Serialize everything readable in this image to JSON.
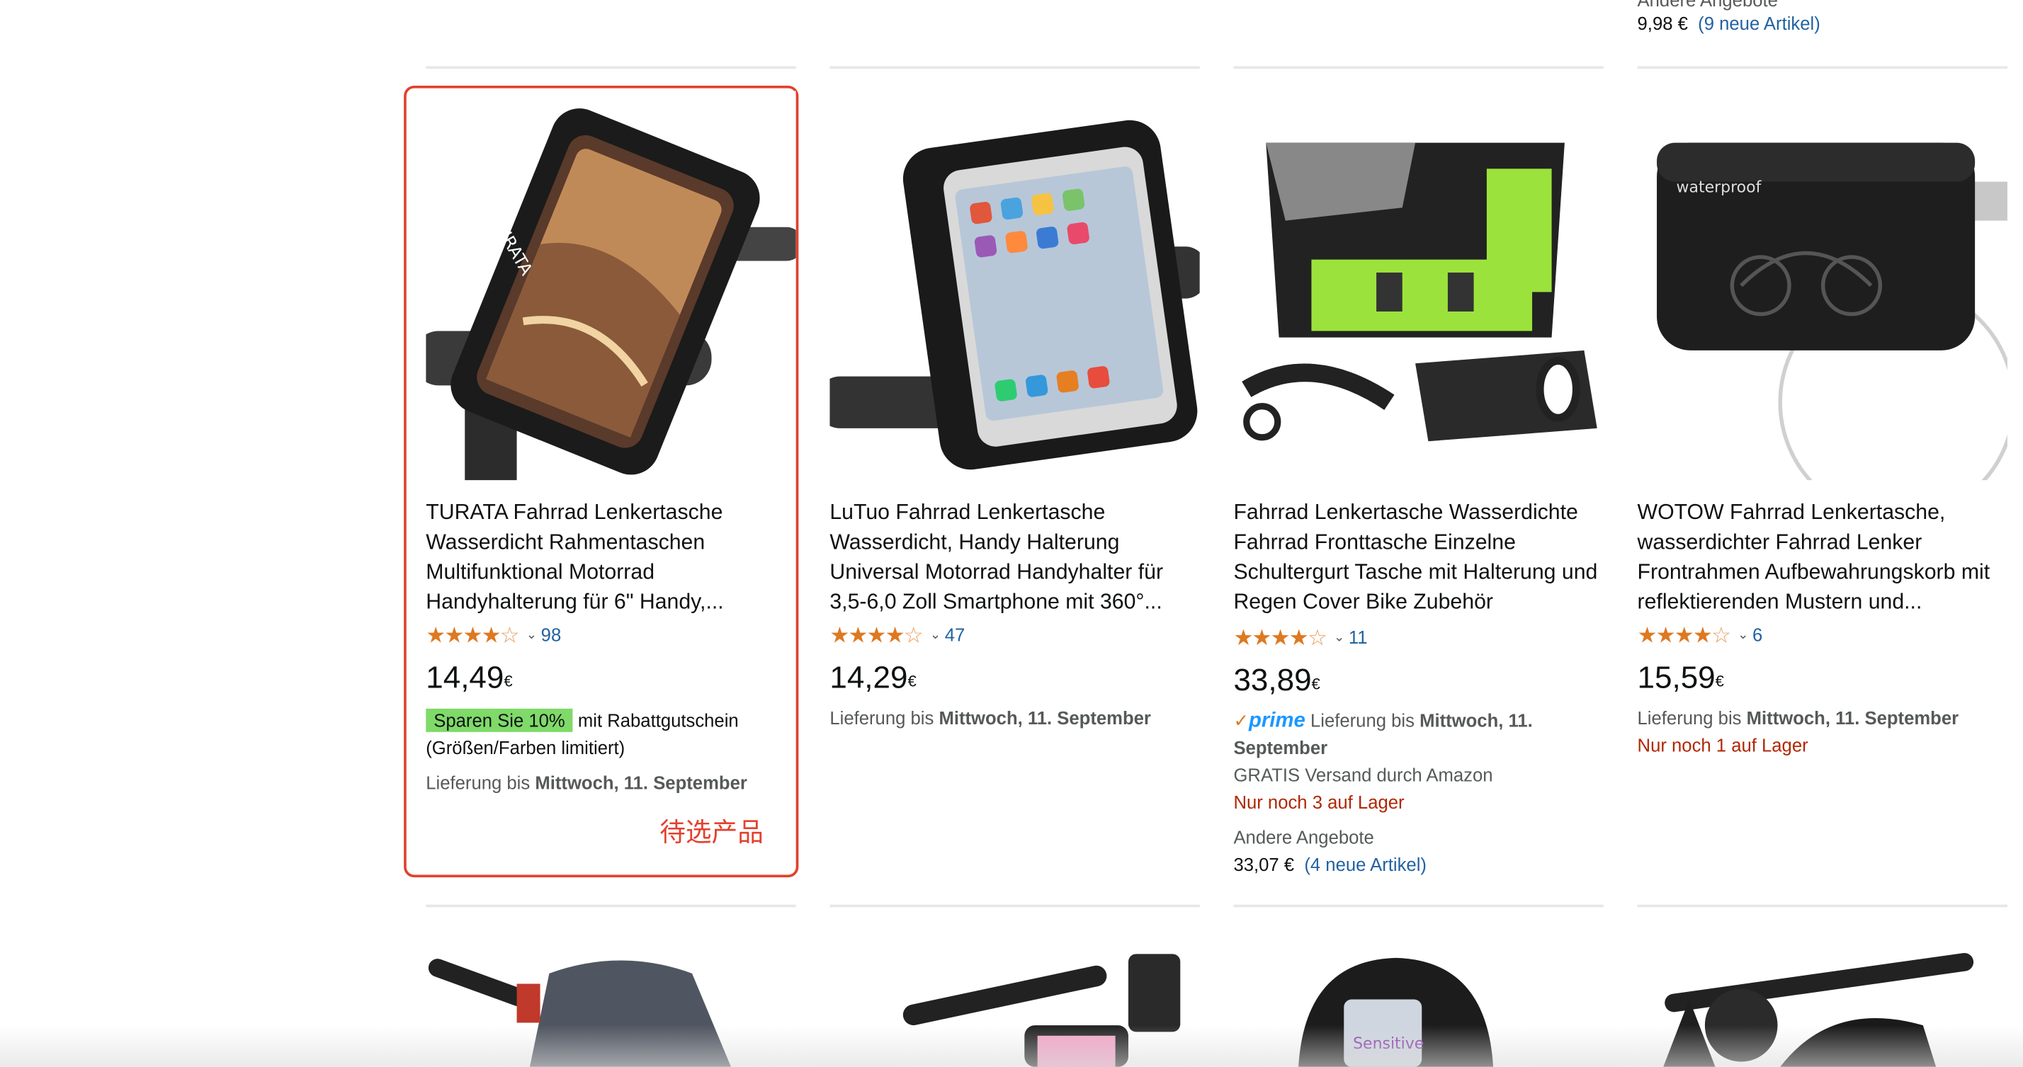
{
  "top_offer": {
    "label": "Andere Angebote",
    "price": "9,98 €",
    "link": "(9 neue Artikel)"
  },
  "candidate_label": "待选产品",
  "products": [
    {
      "title": "TURATA Fahrrad Lenkertasche Wasserdicht Rahmentaschen Multifunktional Motorrad Handyhalterung für 6\" Handy,...",
      "rating": 4.5,
      "reviews": "98",
      "price_main": "14,49",
      "price_cur": "€",
      "coupon": "Sparen Sie 10%",
      "coupon_text": "mit Rabattgutschein (Größen/Farben limitiert)",
      "delivery_prefix": "Lieferung bis",
      "delivery_date": "Mittwoch, 11. September"
    },
    {
      "title": "LuTuo Fahrrad Lenkertasche Wasserdicht, Handy Halterung Universal Motorrad Handyhalter für 3,5-6,0 Zoll Smartphone mit 360°...",
      "rating": 4.5,
      "reviews": "47",
      "price_main": "14,29",
      "price_cur": "€",
      "delivery_prefix": "Lieferung bis",
      "delivery_date": "Mittwoch, 11. September"
    },
    {
      "title": "Fahrrad Lenkertasche Wasserdichte Fahrrad Fronttasche Einzelne Schultergurt Tasche mit Halterung und Regen Cover Bike Zubehör",
      "rating": 4.5,
      "reviews": "11",
      "price_main": "33,89",
      "price_cur": "€",
      "prime": "prime",
      "delivery_prefix": "Lieferung bis",
      "delivery_date": "Mittwoch, 11. September",
      "shipping": "GRATIS Versand durch Amazon",
      "stock": "Nur noch 3 auf Lager",
      "other_label": "Andere Angebote",
      "other_price": "33,07 €",
      "other_link": "(4 neue Artikel)"
    },
    {
      "title": "WOTOW Fahrrad Lenkertasche, wasserdichter Fahrrad Lenker Frontrahmen Aufbewahrungskorb mit reflektierenden Mustern und...",
      "rating": 4,
      "reviews": "6",
      "price_main": "15,59",
      "price_cur": "€",
      "delivery_prefix": "Lieferung bis",
      "delivery_date": "Mittwoch, 11. September",
      "stock": "Nur noch 1 auf Lager"
    }
  ],
  "colors": {
    "star": "#de7921",
    "link": "#2162a1",
    "stock": "#b12704",
    "highlight": "#e2412e",
    "coupon": "#7fda69",
    "prime": "#1a98ff"
  }
}
